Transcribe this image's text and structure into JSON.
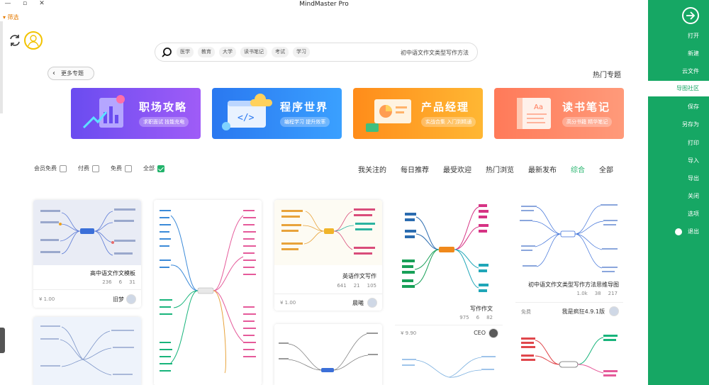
{
  "window": {
    "title": "MindMaster Pro",
    "controls": [
      "—",
      "▫",
      "✕"
    ]
  },
  "filter_link": "▾ 筛选",
  "search": {
    "query": "初中语文作文类型写作方法",
    "chips": [
      "医学",
      "教育",
      "大学",
      "读书笔记",
      "考试",
      "学习"
    ]
  },
  "section": {
    "title": "热门专题",
    "more_label": "更多专题"
  },
  "banners": [
    {
      "title": "职场攻略",
      "sub": "求职面试 技能充电",
      "color_from": "#6a4cf0",
      "color_to": "#9f5cf7"
    },
    {
      "title": "程序世界",
      "sub": "编程学习 提升效率",
      "color_from": "#2a78f0",
      "color_to": "#3aa0ff"
    },
    {
      "title": "产品经理",
      "sub": "实战合集 入门到精通",
      "color_from": "#ff8c1a",
      "color_to": "#ffb733"
    },
    {
      "title": "读书笔记",
      "sub": "高分书籍 精华笔记",
      "color_from": "#ff7a59",
      "color_to": "#ff9a7a"
    }
  ],
  "filters": {
    "items": [
      {
        "label": "全部",
        "checked": true
      },
      {
        "label": "免费",
        "checked": false
      },
      {
        "label": "付费",
        "checked": false
      },
      {
        "label": "会员免费",
        "checked": false
      }
    ]
  },
  "tabs": [
    {
      "label": "全部",
      "active": false
    },
    {
      "label": "综合",
      "active": true
    },
    {
      "label": "最新发布",
      "active": false
    },
    {
      "label": "热门浏览",
      "active": false
    },
    {
      "label": "最受欢迎",
      "active": false
    },
    {
      "label": "每日推荐",
      "active": false
    },
    {
      "label": "我关注的",
      "active": false
    }
  ],
  "cards": [
    {
      "title": "高中语文作文模板",
      "views": "236",
      "likes": "6",
      "favs": "31",
      "price": "¥ 1.00",
      "author": "旧梦"
    },
    {
      "title": "",
      "views": "",
      "likes": "",
      "favs": "",
      "price": "",
      "author": ""
    },
    {
      "title": "英语作文写作",
      "views": "641",
      "likes": "21",
      "favs": "105",
      "price": "¥ 1.00",
      "author": "晨曦"
    },
    {
      "title": "写作作文",
      "views": "975",
      "likes": "6",
      "favs": "82",
      "price": "¥ 9.90",
      "author": "CEO"
    },
    {
      "title": "初中语文作文类型写作方法思维导图",
      "views": "1.0k",
      "likes": "38",
      "favs": "217",
      "price": "免费",
      "author": "我是疯狂4.9.1版"
    }
  ],
  "sidebar": {
    "items": [
      "打开",
      "新建",
      "云文件",
      "导图社区",
      "保存",
      "另存为",
      "打印",
      "导入",
      "导出",
      "关闭",
      "选项",
      "退出"
    ],
    "active_index": 3
  }
}
